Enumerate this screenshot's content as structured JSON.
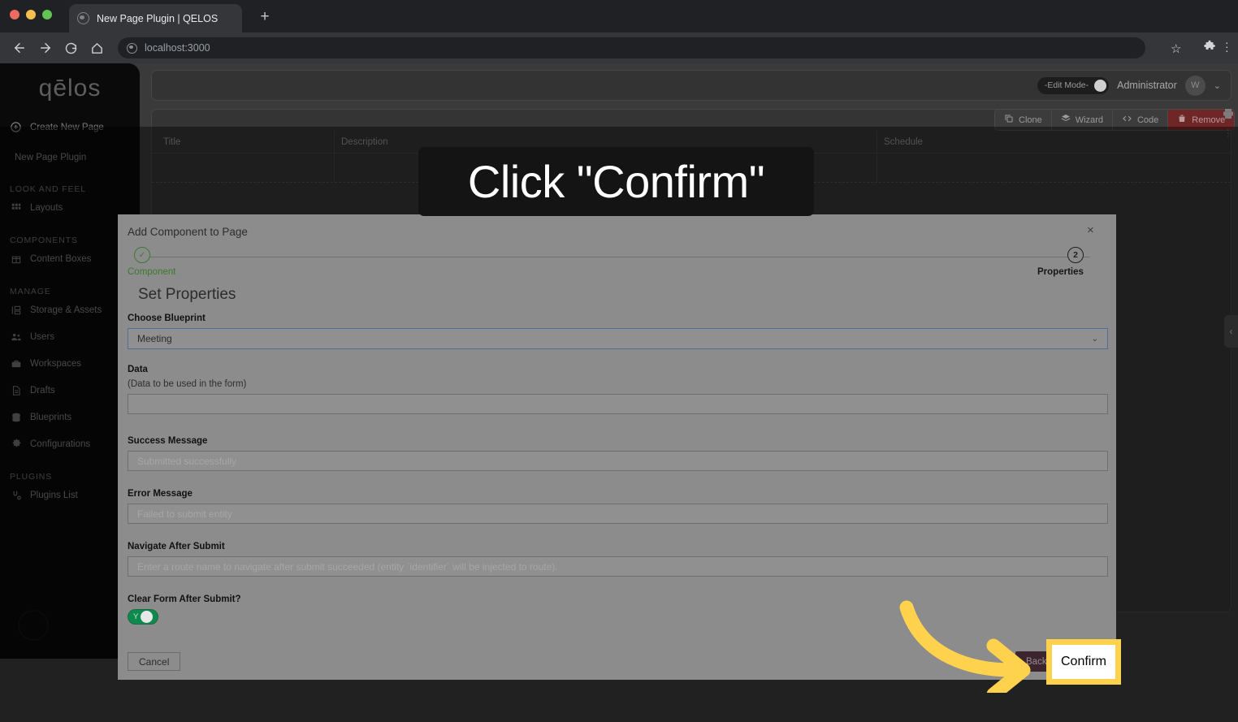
{
  "browser": {
    "tab_title": "New Page Plugin | QELOS",
    "url": "localhost:3000",
    "new_tab_label": "+",
    "icons": {
      "back": "back-arrow-icon",
      "forward": "forward-arrow-icon",
      "reload": "reload-icon",
      "home": "home-icon",
      "bookmark": "star-icon",
      "extensions": "puzzle-icon",
      "menu": "kebab-menu-icon"
    }
  },
  "sidebar": {
    "brand": "qēlos",
    "create_new_page": "Create New Page",
    "current_page": "New Page Plugin",
    "sections": [
      {
        "title": "LOOK AND FEEL",
        "items": [
          {
            "label": "Layouts",
            "icon": "grid-icon"
          }
        ]
      },
      {
        "title": "COMPONENTS",
        "items": [
          {
            "label": "Content Boxes",
            "icon": "box-icon"
          }
        ]
      },
      {
        "title": "MANAGE",
        "items": [
          {
            "label": "Storage & Assets",
            "icon": "storage-icon"
          },
          {
            "label": "Users",
            "icon": "users-icon"
          },
          {
            "label": "Workspaces",
            "icon": "briefcase-icon"
          },
          {
            "label": "Drafts",
            "icon": "document-icon"
          },
          {
            "label": "Blueprints",
            "icon": "database-icon"
          },
          {
            "label": "Configurations",
            "icon": "gear-icon"
          }
        ]
      },
      {
        "title": "PLUGINS",
        "items": [
          {
            "label": "Plugins List",
            "icon": "plugin-icon"
          }
        ]
      }
    ]
  },
  "topbar": {
    "edit_mode_label": "-Edit Mode-",
    "admin_name": "Administrator",
    "avatar_initial": "W",
    "chevron": "⌄"
  },
  "action_bar": {
    "buttons": [
      {
        "label": "Clone",
        "icon": "clone-icon"
      },
      {
        "label": "Wizard",
        "icon": "wizard-icon"
      },
      {
        "label": "Code",
        "icon": "code-icon"
      },
      {
        "label": "Remove",
        "icon": "trash-icon"
      }
    ]
  },
  "table": {
    "headers": [
      "Title",
      "Description",
      "Schedule"
    ]
  },
  "modal": {
    "title": "Add Component to Page",
    "close_label": "×",
    "steps": [
      {
        "number": "✓",
        "label": "Component",
        "state": "complete"
      },
      {
        "number": "2",
        "label": "Properties",
        "state": "active"
      }
    ],
    "heading": "Set Properties",
    "fields": {
      "blueprint": {
        "label": "Choose Blueprint",
        "value": "Meeting",
        "chevron": "⌄"
      },
      "data": {
        "label": "Data",
        "hint": "(Data to be used in the form)",
        "value": "",
        "placeholder": ""
      },
      "success": {
        "label": "Success Message",
        "placeholder": "Submitted successfully"
      },
      "error": {
        "label": "Error Message",
        "placeholder": "Failed to submit entity"
      },
      "navigate": {
        "label": "Navigate After Submit",
        "placeholder": "Enter a route name to navigate after submit succeeded (entity `identifier` will be injected to route)."
      },
      "clear": {
        "label": "Clear Form After Submit?",
        "toggle_value": "Y"
      }
    },
    "buttons": {
      "cancel": "Cancel",
      "back": "Back",
      "confirm": "Confirm"
    }
  },
  "annotation": {
    "instruction": "Click \"Confirm\"",
    "highlight_color": "#ffd24d",
    "arrow_color": "#ffd24d"
  }
}
